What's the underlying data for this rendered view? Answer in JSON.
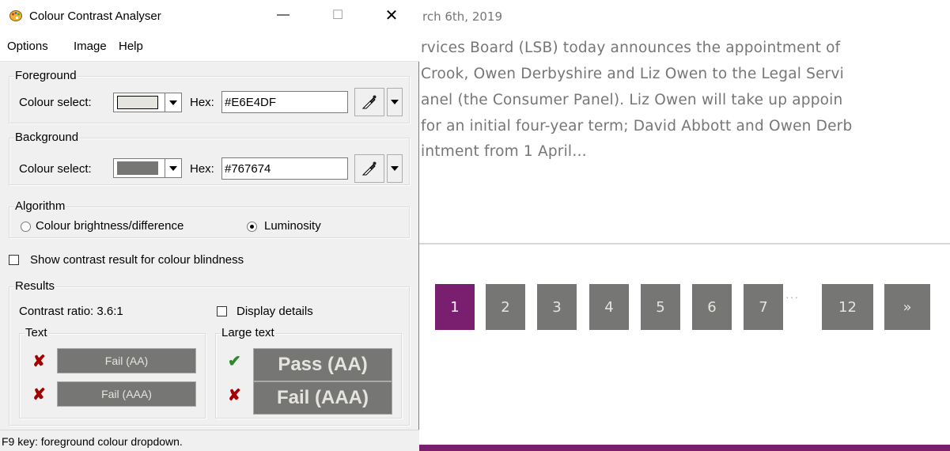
{
  "webpage": {
    "article_date": "rch 6th, 2019",
    "article_lines": [
      "rvices Board (LSB) today announces the appointment of",
      "Crook, Owen Derbyshire and Liz Owen to the Legal Servi",
      "anel (the Consumer Panel). Liz Owen will take up appoin",
      "for an initial four-year term; David Abbott and Owen Derb",
      "intment from 1 April…"
    ],
    "pagination": {
      "pages": [
        "1",
        "2",
        "3",
        "4",
        "5",
        "6",
        "7"
      ],
      "ellipsis": "···",
      "last_page": "12",
      "next_label": "»",
      "active_page": "1"
    },
    "colors": {
      "accent": "#7A1F6F",
      "text": "#767674",
      "button": "#767674"
    }
  },
  "window": {
    "title": "Colour Contrast Analyser",
    "controls": {
      "minimize": "—",
      "maximize": "☐",
      "close": "✕"
    },
    "menu": [
      "Options",
      "Image",
      "Help"
    ],
    "foreground": {
      "group_label": "Foreground",
      "colour_select_label": "Colour select:",
      "hex_label": "Hex:",
      "hex_value": "#E6E4DF",
      "swatch_color": "#E6E4DF",
      "picker_icon": "eyedropper-icon"
    },
    "background": {
      "group_label": "Background",
      "colour_select_label": "Colour select:",
      "hex_label": "Hex:",
      "hex_value": "#767674",
      "swatch_color": "#767674",
      "picker_icon": "eyedropper-icon"
    },
    "algorithm": {
      "group_label": "Algorithm",
      "options": [
        "Colour brightness/difference",
        "Luminosity"
      ],
      "selected": "Luminosity"
    },
    "colour_blindness_checkbox": {
      "label": "Show contrast result for colour blindness",
      "checked": false
    },
    "results": {
      "group_label": "Results",
      "contrast_ratio": "Contrast ratio: 3.6:1",
      "display_details": {
        "label": "Display details",
        "checked": false
      },
      "text": {
        "group_label": "Text",
        "aa": {
          "label": "Fail (AA)",
          "status": "fail"
        },
        "aaa": {
          "label": "Fail (AAA)",
          "status": "fail"
        }
      },
      "large_text": {
        "group_label": "Large text",
        "aa": {
          "label": "Pass (AA)",
          "status": "pass"
        },
        "aaa": {
          "label": "Fail (AAA)",
          "status": "fail"
        }
      }
    },
    "status_bar": "F9 key: foreground colour dropdown."
  }
}
